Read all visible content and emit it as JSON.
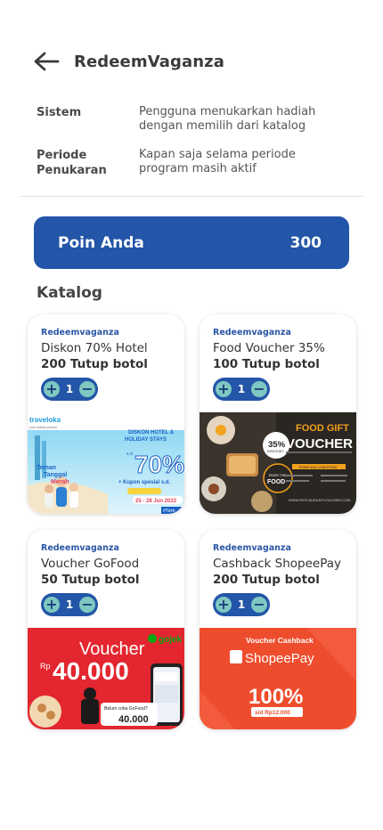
{
  "header": {
    "title": "RedeemVaganza",
    "back_icon": "arrow-left-icon"
  },
  "info": [
    {
      "label": "Sistem",
      "value": "Pengguna menukarkan hadiah dengan memilih dari katalog"
    },
    {
      "label": "Periode Penukaran",
      "value": "Kapan saja selama periode program masih aktif"
    }
  ],
  "points": {
    "label": "Poin Anda",
    "value": "300"
  },
  "catalog_title": "Katalog",
  "colors": {
    "primary": "#2355a8",
    "stepper_button": "#7ec8c1"
  },
  "items": [
    {
      "brand": "Redeemvaganza",
      "name": "Diskon 70% Hotel",
      "cost": "200 Tutup botol",
      "qty": "1",
      "banner": {
        "logo": "traveloka",
        "tagline": "your holiday partner",
        "headline_1": "DISKON HOTEL &",
        "headline_2": "HOLIDAY STAYS",
        "upto": "s.d.",
        "percent": "70%",
        "promo": "+ Kupon spesial s.d.",
        "event_1": "Teman",
        "event_2": "Tanggal",
        "event_3": "Merah",
        "date": "25 - 28 Jun 2022",
        "hashtag": "#Tem"
      }
    },
    {
      "brand": "Redeemvaganza",
      "name": "Food Voucher 35%",
      "cost": "100 Tutup botol",
      "qty": "1",
      "banner": {
        "title_1": "FOOD GIFT",
        "title_2": "VOUCHER",
        "discount": "35%",
        "discount_label": "DISCOUNT",
        "enjoy": "ENJOY THE",
        "food": "FOOD",
        "terms": "TERMS AND CONDITIONS",
        "website": "WWW.RESTAURANTVOUCHER.COM"
      }
    },
    {
      "brand": "Redeemvaganza",
      "name": "Voucher GoFood",
      "cost": "50 Tutup botol",
      "qty": "1",
      "banner": {
        "title": "Voucher",
        "currency": "Rp",
        "amount": "40.000",
        "logo": "gojek",
        "phone_text": "Belum coba GoFood?",
        "phone_amount": "40.000"
      }
    },
    {
      "brand": "Redeemvaganza",
      "name": "Cashback ShopeePay",
      "cost": "200 Tutup botol",
      "qty": "1",
      "banner": {
        "title": "Voucher Cashback",
        "logo": "ShopeePay",
        "percent": "100%",
        "cap": "s/d Rp12.000"
      }
    }
  ]
}
